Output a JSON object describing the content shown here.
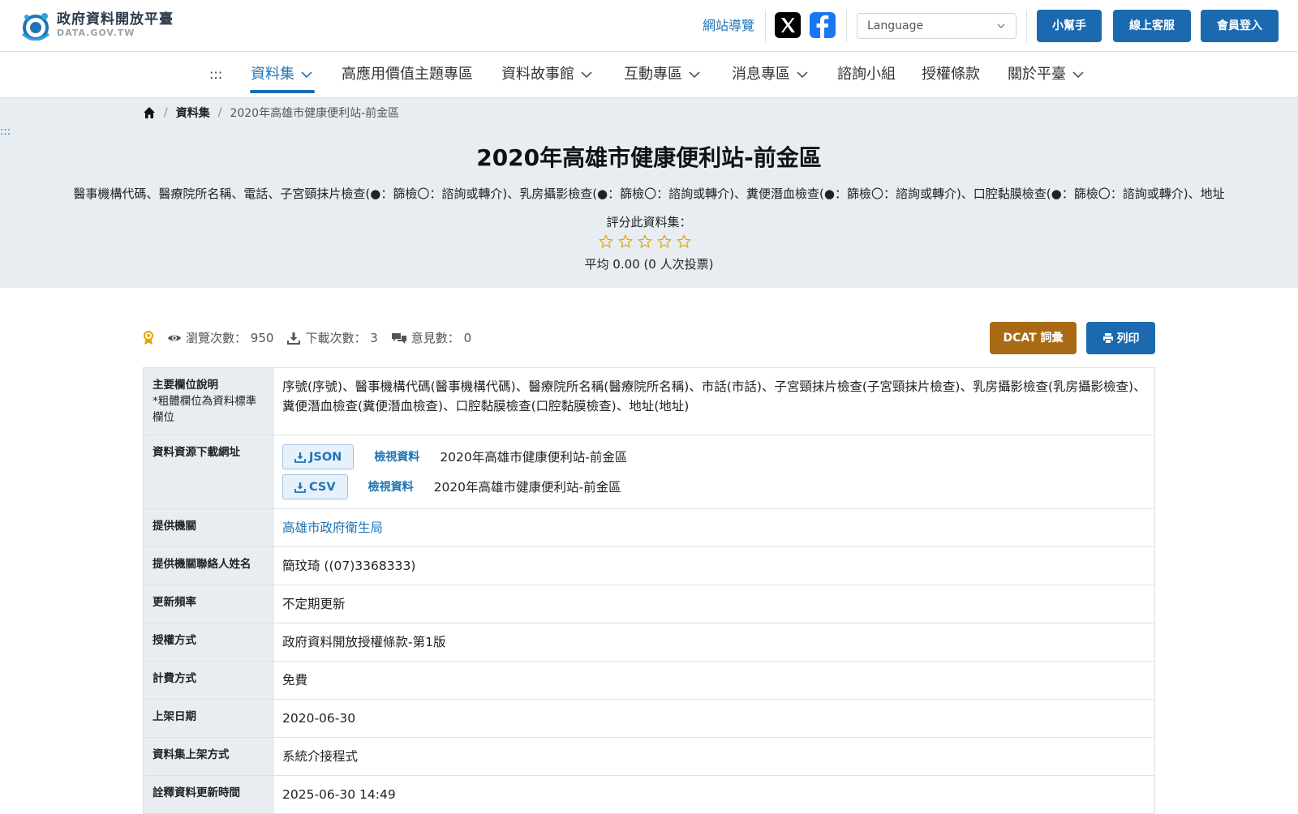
{
  "header": {
    "logo_title": "政府資料開放平臺",
    "logo_sub": "DATA.GOV.TW",
    "sitemap": "網站導覽",
    "language_placeholder": "Language",
    "buttons": [
      "小幫手",
      "線上客服",
      "會員登入"
    ],
    "colors": {
      "primary": "#1b6ab0",
      "link": "#1f74b6",
      "dcat": "#a86a12"
    }
  },
  "nav": {
    "accesskey": ":::",
    "items": [
      {
        "label": "資料集",
        "dropdown": true,
        "active": true
      },
      {
        "label": "高應用價值主題專區",
        "dropdown": false
      },
      {
        "label": "資料故事館",
        "dropdown": true
      },
      {
        "label": "互動專區",
        "dropdown": true
      },
      {
        "label": "消息專區",
        "dropdown": true
      },
      {
        "label": "諮詢小組",
        "dropdown": false
      },
      {
        "label": "授權條款",
        "dropdown": false
      },
      {
        "label": "關於平臺",
        "dropdown": true
      }
    ]
  },
  "breadcrumb": {
    "home_icon": "home-icon",
    "section": "資料集",
    "current": "2020年高雄市健康便利站-前金區"
  },
  "hero": {
    "accesskey": ":::",
    "title": "2020年高雄市健康便利站-前金區",
    "description": "醫事機構代碼、醫療院所名稱、電話、子宮頸抹片檢查(●：篩檢〇：諮詢或轉介)、乳房攝影檢查(●：篩檢〇：諮詢或轉介)、糞便潛血檢查(●：篩檢〇：諮詢或轉介)、口腔黏膜檢查(●：篩檢〇：諮詢或轉介)、地址",
    "rate_label": "評分此資料集：",
    "rating": 0,
    "rating_max": 5,
    "average": "平均 0.00 (0 人次投票)"
  },
  "stats": {
    "views_label": "瀏覽次數：",
    "views": "950",
    "downloads_label": "下載次數：",
    "downloads": "3",
    "comments_label": "意見數：",
    "comments": "0",
    "dcat_button": "DCAT 詞彙",
    "print_button": "列印"
  },
  "info": {
    "fields": {
      "label": "主要欄位說明",
      "note": "*粗體欄位為資料標準欄位",
      "value": "序號(序號)、醫事機構代碼(醫事機構代碼)、醫療院所名稱(醫療院所名稱)、市話(市話)、子宮頸抹片檢查(子宮頸抹片檢查)、乳房攝影檢查(乳房攝影檢查)、糞便潛血檢查(糞便潛血檢查)、口腔黏膜檢查(口腔黏膜檢查)、地址(地址)"
    },
    "resources": {
      "label": "資料資源下載網址",
      "items": [
        {
          "format": "JSON",
          "view": "檢視資料",
          "name": "2020年高雄市健康便利站-前金區"
        },
        {
          "format": "CSV",
          "view": "檢視資料",
          "name": "2020年高雄市健康便利站-前金區"
        }
      ]
    },
    "provider": {
      "label": "提供機關",
      "value": "高雄市政府衛生局"
    },
    "contact": {
      "label": "提供機關聯絡人姓名",
      "value": "簡玟琦 ((07)3368333)"
    },
    "frequency": {
      "label": "更新頻率",
      "value": "不定期更新"
    },
    "license": {
      "label": "授權方式",
      "value": "政府資料開放授權條款-第1版"
    },
    "fee": {
      "label": "計費方式",
      "value": "免費"
    },
    "published": {
      "label": "上架日期",
      "value": "2020-06-30"
    },
    "method": {
      "label": "資料集上架方式",
      "value": "系統介接程式"
    },
    "updated": {
      "label": "詮釋資料更新時間",
      "value": "2025-06-30 14:49"
    }
  }
}
